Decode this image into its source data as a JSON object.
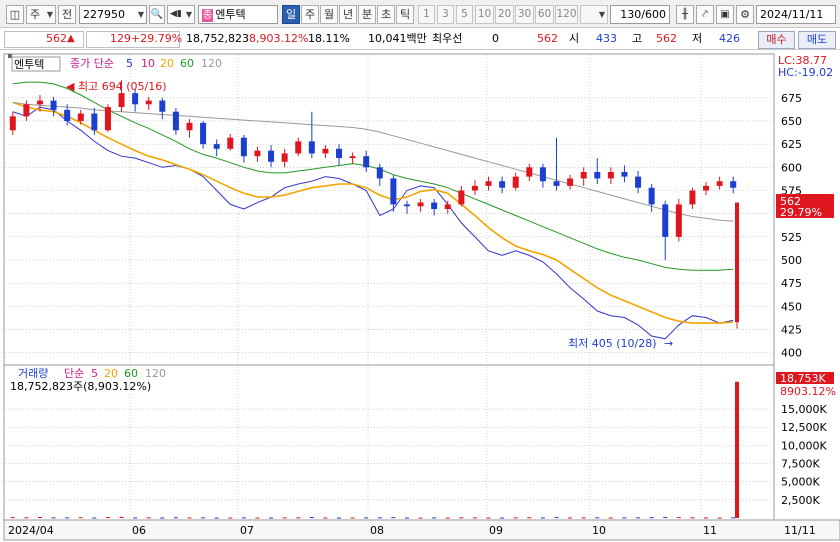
{
  "toolbar": {
    "type_select": "주",
    "prev_label": "전",
    "stock_code": "227950",
    "badge": "종",
    "stock_name": "엔투텍",
    "periods": [
      "일",
      "주",
      "월",
      "년",
      "분",
      "초",
      "틱"
    ],
    "active_period": "일",
    "intervals": [
      "1",
      "3",
      "5",
      "10",
      "20",
      "30",
      "60",
      "120"
    ],
    "count_display": "130/600",
    "date": "2024/11/11"
  },
  "price_bar": {
    "price": "562",
    "change": "129",
    "change_pct": "+29.79%",
    "volume": "18,752,823",
    "volume_ratio": "8,903.12%",
    "turnover": "18.11%",
    "amount": "10,041백만",
    "best_bid_label": "최우선",
    "best_bid": "0",
    "ask_price": "562",
    "open_label": "시",
    "open": "433",
    "high_label": "고",
    "high": "562",
    "low_label": "저",
    "low": "426",
    "buy_label": "매수",
    "sell_label": "매도"
  },
  "colors": {
    "up": "#e0161f",
    "down": "#1c3fcf",
    "ma5": "#3333cc",
    "ma10": "#cc1a8c",
    "ma20": "#f0a500",
    "ma60": "#229922",
    "ma120": "#999999",
    "grid": "#b4b4b4",
    "frame": "#9a9a9a"
  },
  "chart_data": {
    "type": "candlestick",
    "panel_label": "엔투텍",
    "legend_prefix": "종가 단순",
    "ma_legend": [
      "5",
      "10",
      "20",
      "60",
      "120"
    ],
    "right_top_lc": "LC:38.77",
    "right_top_hc": "HC:-19.02",
    "price_ticks": [
      675,
      650,
      625,
      600,
      575,
      550,
      525,
      500,
      475,
      450,
      425,
      400
    ],
    "price_range": [
      390,
      705
    ],
    "current_price_label": "562",
    "current_change_label": "29.79%",
    "high_annotation": "최고 694 (05/16)",
    "low_annotation": "최저 405 (10/28)",
    "month_labels": [
      "2024/04",
      "06",
      "07",
      "08",
      "09",
      "10",
      "11"
    ],
    "right_date_label": "11/11",
    "volume_panel_label": "거래량",
    "volume_legend_prefix": "단순",
    "volume_ma_legend": [
      "5",
      "20",
      "60",
      "120"
    ],
    "volume_info": "18,752,823주(8,903.12%)",
    "volume_current_label": "18,753K",
    "volume_ratio_label": "8903.12%",
    "volume_ticks": [
      "15,000K",
      "12,500K",
      "10,000K",
      "7,500K",
      "5,000K",
      "2,500K"
    ],
    "volume_tick_values": [
      15000,
      12500,
      10000,
      7500,
      5000,
      2500
    ],
    "volume_range": [
      0,
      19000
    ],
    "last_volume_k": 18753,
    "series": [
      {
        "name": "5",
        "values": [
          660,
          655,
          665,
          662,
          650,
          640,
          628,
          618,
          612,
          610,
          605,
          600,
          602,
          598,
          590,
          575,
          560,
          555,
          562,
          568,
          578,
          582,
          585,
          590,
          588,
          582,
          575,
          548,
          555,
          575,
          580,
          578,
          560,
          540,
          525,
          510,
          505,
          510,
          505,
          498,
          485,
          470,
          458,
          445,
          440,
          438,
          430,
          418,
          415,
          430,
          440,
          438,
          432,
          435
        ]
      },
      {
        "name": "20",
        "values": [
          670,
          665,
          662,
          660,
          655,
          648,
          640,
          632,
          625,
          618,
          612,
          608,
          603,
          598,
          592,
          585,
          578,
          572,
          568,
          568,
          570,
          574,
          578,
          580,
          582,
          582,
          578,
          570,
          565,
          568,
          574,
          576,
          572,
          560,
          548,
          535,
          524,
          515,
          510,
          506,
          500,
          490,
          480,
          470,
          462,
          456,
          450,
          444,
          438,
          434,
          432,
          432,
          432,
          433
        ]
      },
      {
        "name": "60",
        "values": [
          690,
          692,
          692,
          690,
          685,
          678,
          670,
          662,
          655,
          648,
          642,
          635,
          628,
          620,
          614,
          610,
          605,
          600,
          596,
          594,
          594,
          596,
          598,
          600,
          602,
          604,
          602,
          598,
          592,
          588,
          585,
          582,
          578,
          572,
          566,
          560,
          554,
          548,
          542,
          536,
          530,
          524,
          518,
          512,
          507,
          503,
          500,
          496,
          492,
          490,
          489,
          489,
          489,
          490
        ]
      },
      {
        "name": "120",
        "values": [
          670,
          668,
          667,
          666,
          665,
          664,
          662,
          661,
          660,
          659,
          658,
          657,
          656,
          655,
          654,
          653,
          652,
          651,
          650,
          649,
          648,
          647,
          646,
          645,
          644,
          643,
          641,
          638,
          634,
          630,
          626,
          622,
          618,
          614,
          610,
          606,
          602,
          598,
          594,
          590,
          586,
          582,
          578,
          574,
          570,
          566,
          562,
          558,
          554,
          550,
          547,
          545,
          543,
          542
        ]
      }
    ],
    "candles": [
      [
        640,
        655,
        635,
        660
      ],
      [
        655,
        668,
        650,
        672
      ],
      [
        668,
        672,
        660,
        678
      ],
      [
        672,
        662,
        655,
        676
      ],
      [
        662,
        650,
        645,
        668
      ],
      [
        650,
        658,
        646,
        662
      ],
      [
        658,
        640,
        635,
        664
      ],
      [
        640,
        665,
        638,
        668
      ],
      [
        665,
        680,
        660,
        694
      ],
      [
        680,
        668,
        660,
        684
      ],
      [
        668,
        672,
        662,
        676
      ],
      [
        672,
        660,
        652,
        675
      ],
      [
        660,
        640,
        635,
        664
      ],
      [
        640,
        648,
        632,
        652
      ],
      [
        648,
        625,
        620,
        650
      ],
      [
        625,
        620,
        612,
        630
      ],
      [
        620,
        632,
        618,
        636
      ],
      [
        632,
        612,
        605,
        635
      ],
      [
        612,
        618,
        606,
        622
      ],
      [
        618,
        606,
        600,
        624
      ],
      [
        606,
        615,
        600,
        620
      ],
      [
        615,
        628,
        612,
        632
      ],
      [
        628,
        615,
        610,
        660
      ],
      [
        615,
        620,
        610,
        624
      ],
      [
        620,
        610,
        602,
        625
      ],
      [
        610,
        612,
        604,
        616
      ],
      [
        612,
        600,
        595,
        618
      ],
      [
        600,
        588,
        580,
        604
      ],
      [
        588,
        560,
        552,
        592
      ],
      [
        560,
        558,
        550,
        564
      ],
      [
        558,
        562,
        552,
        566
      ],
      [
        562,
        555,
        548,
        566
      ],
      [
        555,
        560,
        550,
        564
      ],
      [
        560,
        575,
        558,
        580
      ],
      [
        575,
        580,
        570,
        586
      ],
      [
        580,
        585,
        575,
        590
      ],
      [
        585,
        578,
        572,
        590
      ],
      [
        578,
        590,
        575,
        594
      ],
      [
        590,
        600,
        585,
        604
      ],
      [
        600,
        585,
        578,
        604
      ],
      [
        585,
        580,
        575,
        632
      ],
      [
        580,
        588,
        576,
        592
      ],
      [
        588,
        595,
        580,
        600
      ],
      [
        595,
        588,
        582,
        610
      ],
      [
        588,
        595,
        582,
        600
      ],
      [
        595,
        590,
        584,
        602
      ],
      [
        590,
        578,
        572,
        596
      ],
      [
        578,
        560,
        552,
        582
      ],
      [
        560,
        525,
        500,
        564
      ],
      [
        525,
        560,
        520,
        566
      ],
      [
        560,
        575,
        555,
        578
      ],
      [
        575,
        580,
        570,
        584
      ],
      [
        580,
        585,
        576,
        590
      ],
      [
        585,
        578,
        572,
        590
      ]
    ],
    "volume": [
      120,
      100,
      150,
      90,
      80,
      110,
      70,
      130,
      160,
      80,
      90,
      70,
      100,
      80,
      90,
      60,
      70,
      80,
      70,
      60,
      80,
      90,
      140,
      70,
      60,
      70,
      80,
      90,
      120,
      70,
      60,
      80,
      70,
      90,
      80,
      70,
      60,
      80,
      100,
      80,
      130,
      70,
      80,
      90,
      70,
      80,
      90,
      110,
      140,
      120,
      90,
      80,
      70,
      90
    ]
  }
}
